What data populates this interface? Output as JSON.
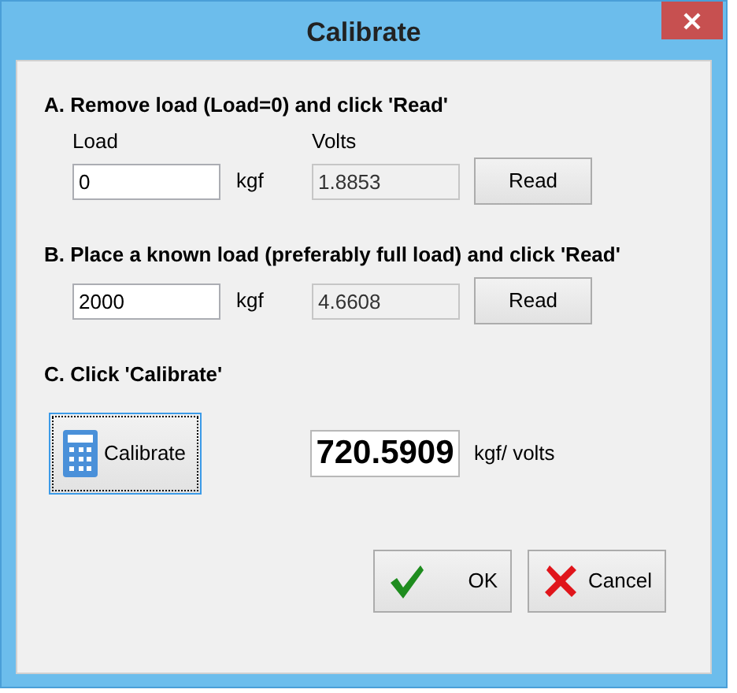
{
  "window": {
    "title": "Calibrate"
  },
  "sections": [
    {
      "heading": "A. Remove load (Load=0) and click 'Read'",
      "load_label": "Load",
      "volts_label": "Volts",
      "load": {
        "value": "0",
        "editable": true
      },
      "unit": "kgf",
      "volts": {
        "value": "1.8853",
        "editable": false
      },
      "button": "Read"
    },
    {
      "heading": "B. Place a known load (preferably full load) and click 'Read'",
      "load": {
        "value": "2000",
        "editable": true
      },
      "unit": "kgf",
      "volts": {
        "value": "4.6608",
        "editable": false
      },
      "button": "Read"
    },
    {
      "heading": "C. Click 'Calibrate'"
    }
  ],
  "calibrate": {
    "label": "Calibrate",
    "focused": true
  },
  "result": {
    "value": "720.5909",
    "unit": "kgf/ volts"
  },
  "buttons": [
    {
      "kind": "ok",
      "label": "OK"
    },
    {
      "kind": "cancel",
      "label": "Cancel"
    }
  ]
}
